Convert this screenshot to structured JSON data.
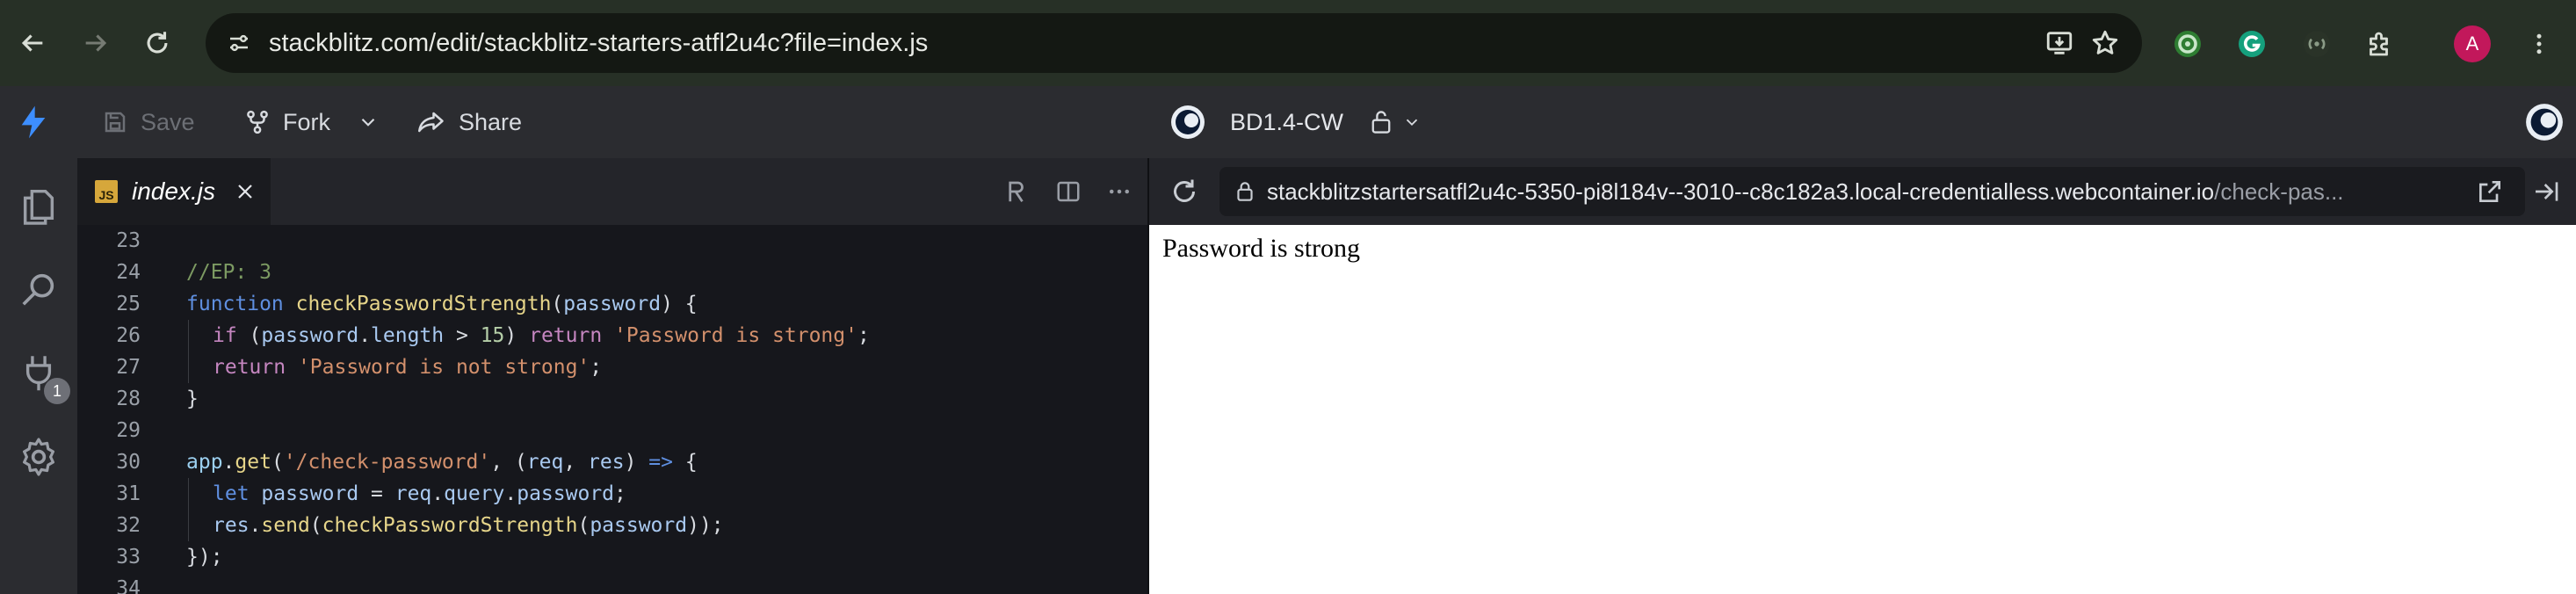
{
  "browser": {
    "url": "stackblitz.com/edit/stackblitz-starters-atfl2u4c?file=index.js",
    "profile_initial": "A",
    "icons": [
      "back-icon",
      "forward-icon",
      "reload-icon",
      "site-info-icon",
      "install-app-icon",
      "bookmark-star-icon",
      "extension-icon",
      "puzzle-icon",
      "more-icon"
    ]
  },
  "header": {
    "save_label": "Save",
    "fork_label": "Fork",
    "share_label": "Share",
    "project_title": "BD1.4-CW"
  },
  "activity": {
    "badge_count": "1"
  },
  "editor": {
    "tab_badge": "JS",
    "tab_label": "index.js",
    "lines": [
      {
        "n": "23"
      },
      {
        "n": "24",
        "tokens": [
          {
            "c": "c-comment",
            "t": "//EP: 3"
          }
        ]
      },
      {
        "n": "25",
        "tokens": [
          {
            "c": "c-kw",
            "t": "function "
          },
          {
            "c": "c-fn",
            "t": "checkPasswordStrength"
          },
          {
            "c": "c-plain",
            "t": "("
          },
          {
            "c": "c-param",
            "t": "password"
          },
          {
            "c": "c-plain",
            "t": ") {"
          }
        ]
      },
      {
        "n": "26",
        "indent": true,
        "tokens": [
          {
            "c": "c-ctrl",
            "t": "if "
          },
          {
            "c": "c-plain",
            "t": "("
          },
          {
            "c": "c-param",
            "t": "password"
          },
          {
            "c": "c-plain",
            "t": "."
          },
          {
            "c": "c-param",
            "t": "length"
          },
          {
            "c": "c-plain",
            "t": " > "
          },
          {
            "c": "c-num",
            "t": "15"
          },
          {
            "c": "c-plain",
            "t": ") "
          },
          {
            "c": "c-ctrl",
            "t": "return "
          },
          {
            "c": "c-str",
            "t": "'Password is strong'"
          },
          {
            "c": "c-plain",
            "t": ";"
          }
        ]
      },
      {
        "n": "27",
        "indent": true,
        "tokens": [
          {
            "c": "c-ctrl",
            "t": "return "
          },
          {
            "c": "c-str",
            "t": "'Password is not strong'"
          },
          {
            "c": "c-plain",
            "t": ";"
          }
        ]
      },
      {
        "n": "28",
        "tokens": [
          {
            "c": "c-plain",
            "t": "}"
          }
        ]
      },
      {
        "n": "29"
      },
      {
        "n": "30",
        "tokens": [
          {
            "c": "c-var",
            "t": "app"
          },
          {
            "c": "c-plain",
            "t": "."
          },
          {
            "c": "c-fn",
            "t": "get"
          },
          {
            "c": "c-plain",
            "t": "("
          },
          {
            "c": "c-str",
            "t": "'/check-password'"
          },
          {
            "c": "c-plain",
            "t": ", ("
          },
          {
            "c": "c-param",
            "t": "req"
          },
          {
            "c": "c-plain",
            "t": ", "
          },
          {
            "c": "c-param",
            "t": "res"
          },
          {
            "c": "c-plain",
            "t": ") "
          },
          {
            "c": "c-kw",
            "t": "=>"
          },
          {
            "c": "c-plain",
            "t": " {"
          }
        ]
      },
      {
        "n": "31",
        "indent": true,
        "tokens": [
          {
            "c": "c-kw",
            "t": "let "
          },
          {
            "c": "c-param",
            "t": "password"
          },
          {
            "c": "c-plain",
            "t": " = "
          },
          {
            "c": "c-param",
            "t": "req"
          },
          {
            "c": "c-plain",
            "t": "."
          },
          {
            "c": "c-param",
            "t": "query"
          },
          {
            "c": "c-plain",
            "t": "."
          },
          {
            "c": "c-param",
            "t": "password"
          },
          {
            "c": "c-plain",
            "t": ";"
          }
        ]
      },
      {
        "n": "32",
        "indent": true,
        "tokens": [
          {
            "c": "c-param",
            "t": "res"
          },
          {
            "c": "c-plain",
            "t": "."
          },
          {
            "c": "c-fn",
            "t": "send"
          },
          {
            "c": "c-plain",
            "t": "("
          },
          {
            "c": "c-fn",
            "t": "checkPasswordStrength"
          },
          {
            "c": "c-plain",
            "t": "("
          },
          {
            "c": "c-param",
            "t": "password"
          },
          {
            "c": "c-plain",
            "t": "));"
          }
        ]
      },
      {
        "n": "33",
        "tokens": [
          {
            "c": "c-plain",
            "t": "});"
          }
        ]
      },
      {
        "n": "34"
      }
    ]
  },
  "preview": {
    "url_main": "stackblitzstartersatfl2u4c-5350-pi8l184v--3010--c8c182a3.local-credentialless.webcontainer.io",
    "url_path": "/check-pas...",
    "body_text": "Password is strong"
  },
  "colors": {
    "browser_bar": "#273026",
    "ide_header": "#2b2c30",
    "editor_bg": "#16171c",
    "js_badge": "#d6a73b"
  }
}
